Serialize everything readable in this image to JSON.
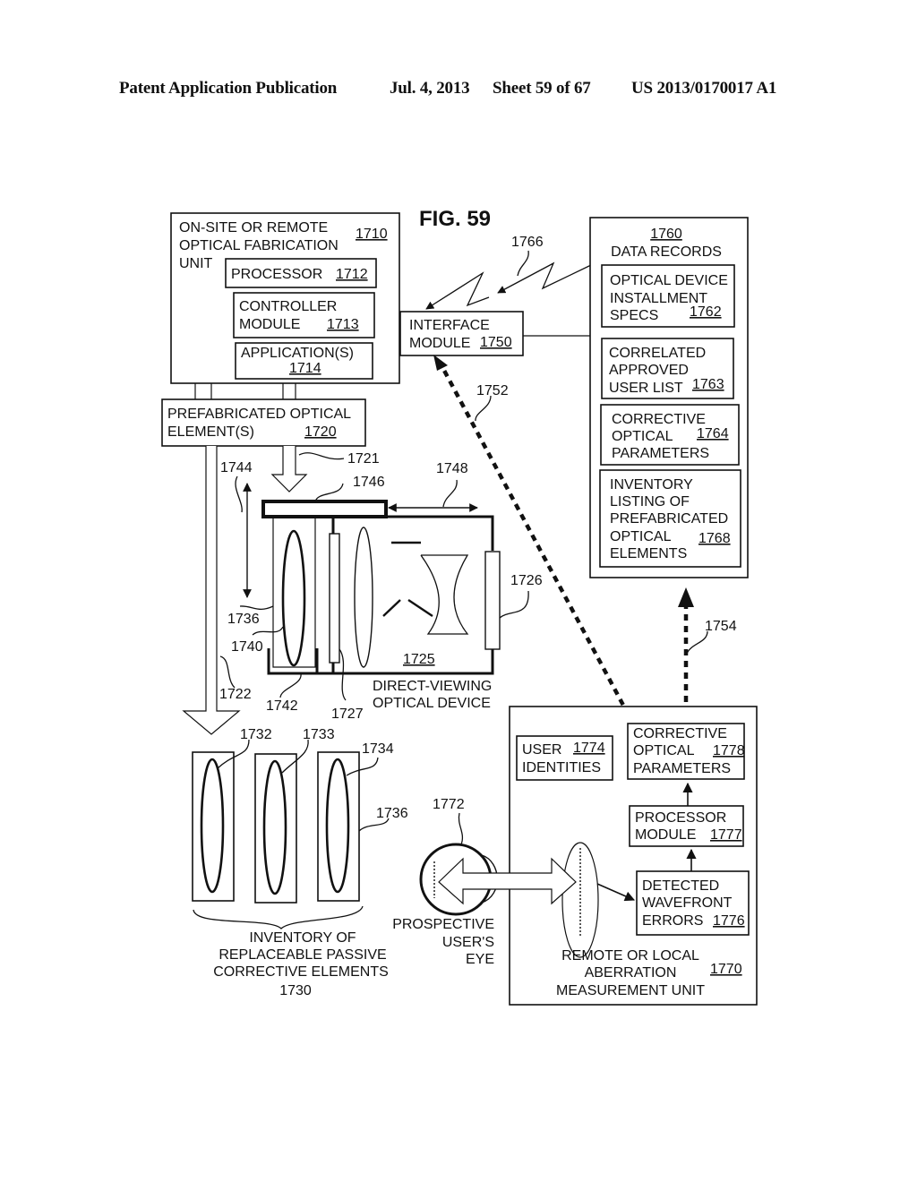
{
  "header": {
    "publication": "Patent Application Publication",
    "date": "Jul. 4, 2013",
    "sheet": "Sheet 59 of 67",
    "number": "US 2013/0170017 A1"
  },
  "figure": {
    "title": "FIG. 59"
  },
  "fabrication_unit": {
    "lines": [
      "ON-SITE OR REMOTE",
      "OPTICAL FABRICATION",
      "UNIT"
    ],
    "ref": "1710",
    "processor": {
      "label": "PROCESSOR",
      "ref": "1712"
    },
    "controller": {
      "lines": [
        "CONTROLLER",
        "MODULE"
      ],
      "ref": "1713"
    },
    "applications": {
      "label": "APPLICATION(S)",
      "ref": "1714"
    }
  },
  "interface_module": {
    "lines": [
      "INTERFACE",
      "MODULE"
    ],
    "ref": "1750"
  },
  "data_records": {
    "ref": "1760",
    "title": "DATA RECORDS",
    "items": [
      {
        "lines": [
          "OPTICAL DEVICE",
          "INSTALLMENT",
          "SPECS"
        ],
        "ref": "1762"
      },
      {
        "lines": [
          "CORRELATED",
          "APPROVED",
          "USER LIST"
        ],
        "ref": "1763"
      },
      {
        "lines": [
          "CORRECTIVE",
          "OPTICAL",
          "PARAMETERS"
        ],
        "ref": "1764"
      },
      {
        "lines": [
          "INVENTORY",
          "LISTING OF",
          "PREFABRICATED",
          "OPTICAL",
          "ELEMENTS"
        ],
        "ref": "1768"
      }
    ]
  },
  "prefab_elements": {
    "lines": [
      "PREFABRICATED OPTICAL",
      "ELEMENT(S)"
    ],
    "ref": "1720"
  },
  "device": {
    "ref": "1725",
    "lines": [
      "DIRECT-VIEWING",
      "OPTICAL DEVICE"
    ]
  },
  "inventory": {
    "lines": [
      "INVENTORY OF",
      "REPLACEABLE PASSIVE",
      "CORRECTIVE ELEMENTS"
    ],
    "ref": "1730"
  },
  "eye": {
    "lines": [
      "PROSPECTIVE",
      "USER'S",
      "EYE"
    ],
    "ref": "1772"
  },
  "measurement_unit": {
    "lines": [
      "REMOTE OR LOCAL",
      "ABERRATION",
      "MEASUREMENT UNIT"
    ],
    "ref": "1770",
    "user_identities": {
      "lines": [
        "USER",
        "IDENTITIES"
      ],
      "ref": "1774"
    },
    "corrective_params": {
      "lines": [
        "CORRECTIVE",
        "OPTICAL",
        "PARAMETERS"
      ],
      "ref": "1778"
    },
    "processor": {
      "lines": [
        "PROCESSOR",
        "MODULE"
      ],
      "ref": "1777"
    },
    "wavefront": {
      "lines": [
        "DETECTED",
        "WAVEFRONT",
        "ERRORS"
      ],
      "ref": "1776"
    }
  },
  "callouts": {
    "c1721": "1721",
    "c1722": "1722",
    "c1726": "1726",
    "c1727": "1727",
    "c1732": "1732",
    "c1733": "1733",
    "c1734": "1734",
    "c1736a": "1736",
    "c1736b": "1736",
    "c1740": "1740",
    "c1742": "1742",
    "c1744": "1744",
    "c1746": "1746",
    "c1748": "1748",
    "c1752": "1752",
    "c1754": "1754",
    "c1766": "1766"
  }
}
